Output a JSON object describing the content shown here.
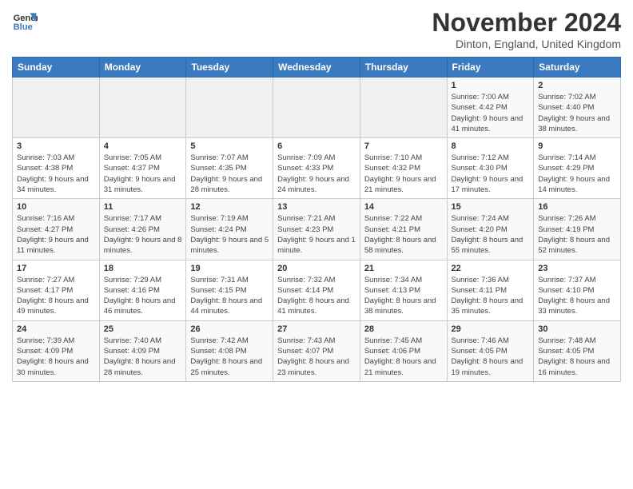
{
  "header": {
    "logo_line1": "General",
    "logo_line2": "Blue",
    "month_title": "November 2024",
    "location": "Dinton, England, United Kingdom"
  },
  "weekdays": [
    "Sunday",
    "Monday",
    "Tuesday",
    "Wednesday",
    "Thursday",
    "Friday",
    "Saturday"
  ],
  "weeks": [
    [
      {
        "day": "",
        "info": ""
      },
      {
        "day": "",
        "info": ""
      },
      {
        "day": "",
        "info": ""
      },
      {
        "day": "",
        "info": ""
      },
      {
        "day": "",
        "info": ""
      },
      {
        "day": "1",
        "info": "Sunrise: 7:00 AM\nSunset: 4:42 PM\nDaylight: 9 hours and 41 minutes."
      },
      {
        "day": "2",
        "info": "Sunrise: 7:02 AM\nSunset: 4:40 PM\nDaylight: 9 hours and 38 minutes."
      }
    ],
    [
      {
        "day": "3",
        "info": "Sunrise: 7:03 AM\nSunset: 4:38 PM\nDaylight: 9 hours and 34 minutes."
      },
      {
        "day": "4",
        "info": "Sunrise: 7:05 AM\nSunset: 4:37 PM\nDaylight: 9 hours and 31 minutes."
      },
      {
        "day": "5",
        "info": "Sunrise: 7:07 AM\nSunset: 4:35 PM\nDaylight: 9 hours and 28 minutes."
      },
      {
        "day": "6",
        "info": "Sunrise: 7:09 AM\nSunset: 4:33 PM\nDaylight: 9 hours and 24 minutes."
      },
      {
        "day": "7",
        "info": "Sunrise: 7:10 AM\nSunset: 4:32 PM\nDaylight: 9 hours and 21 minutes."
      },
      {
        "day": "8",
        "info": "Sunrise: 7:12 AM\nSunset: 4:30 PM\nDaylight: 9 hours and 17 minutes."
      },
      {
        "day": "9",
        "info": "Sunrise: 7:14 AM\nSunset: 4:29 PM\nDaylight: 9 hours and 14 minutes."
      }
    ],
    [
      {
        "day": "10",
        "info": "Sunrise: 7:16 AM\nSunset: 4:27 PM\nDaylight: 9 hours and 11 minutes."
      },
      {
        "day": "11",
        "info": "Sunrise: 7:17 AM\nSunset: 4:26 PM\nDaylight: 9 hours and 8 minutes."
      },
      {
        "day": "12",
        "info": "Sunrise: 7:19 AM\nSunset: 4:24 PM\nDaylight: 9 hours and 5 minutes."
      },
      {
        "day": "13",
        "info": "Sunrise: 7:21 AM\nSunset: 4:23 PM\nDaylight: 9 hours and 1 minute."
      },
      {
        "day": "14",
        "info": "Sunrise: 7:22 AM\nSunset: 4:21 PM\nDaylight: 8 hours and 58 minutes."
      },
      {
        "day": "15",
        "info": "Sunrise: 7:24 AM\nSunset: 4:20 PM\nDaylight: 8 hours and 55 minutes."
      },
      {
        "day": "16",
        "info": "Sunrise: 7:26 AM\nSunset: 4:19 PM\nDaylight: 8 hours and 52 minutes."
      }
    ],
    [
      {
        "day": "17",
        "info": "Sunrise: 7:27 AM\nSunset: 4:17 PM\nDaylight: 8 hours and 49 minutes."
      },
      {
        "day": "18",
        "info": "Sunrise: 7:29 AM\nSunset: 4:16 PM\nDaylight: 8 hours and 46 minutes."
      },
      {
        "day": "19",
        "info": "Sunrise: 7:31 AM\nSunset: 4:15 PM\nDaylight: 8 hours and 44 minutes."
      },
      {
        "day": "20",
        "info": "Sunrise: 7:32 AM\nSunset: 4:14 PM\nDaylight: 8 hours and 41 minutes."
      },
      {
        "day": "21",
        "info": "Sunrise: 7:34 AM\nSunset: 4:13 PM\nDaylight: 8 hours and 38 minutes."
      },
      {
        "day": "22",
        "info": "Sunrise: 7:36 AM\nSunset: 4:11 PM\nDaylight: 8 hours and 35 minutes."
      },
      {
        "day": "23",
        "info": "Sunrise: 7:37 AM\nSunset: 4:10 PM\nDaylight: 8 hours and 33 minutes."
      }
    ],
    [
      {
        "day": "24",
        "info": "Sunrise: 7:39 AM\nSunset: 4:09 PM\nDaylight: 8 hours and 30 minutes."
      },
      {
        "day": "25",
        "info": "Sunrise: 7:40 AM\nSunset: 4:09 PM\nDaylight: 8 hours and 28 minutes."
      },
      {
        "day": "26",
        "info": "Sunrise: 7:42 AM\nSunset: 4:08 PM\nDaylight: 8 hours and 25 minutes."
      },
      {
        "day": "27",
        "info": "Sunrise: 7:43 AM\nSunset: 4:07 PM\nDaylight: 8 hours and 23 minutes."
      },
      {
        "day": "28",
        "info": "Sunrise: 7:45 AM\nSunset: 4:06 PM\nDaylight: 8 hours and 21 minutes."
      },
      {
        "day": "29",
        "info": "Sunrise: 7:46 AM\nSunset: 4:05 PM\nDaylight: 8 hours and 19 minutes."
      },
      {
        "day": "30",
        "info": "Sunrise: 7:48 AM\nSunset: 4:05 PM\nDaylight: 8 hours and 16 minutes."
      }
    ]
  ]
}
